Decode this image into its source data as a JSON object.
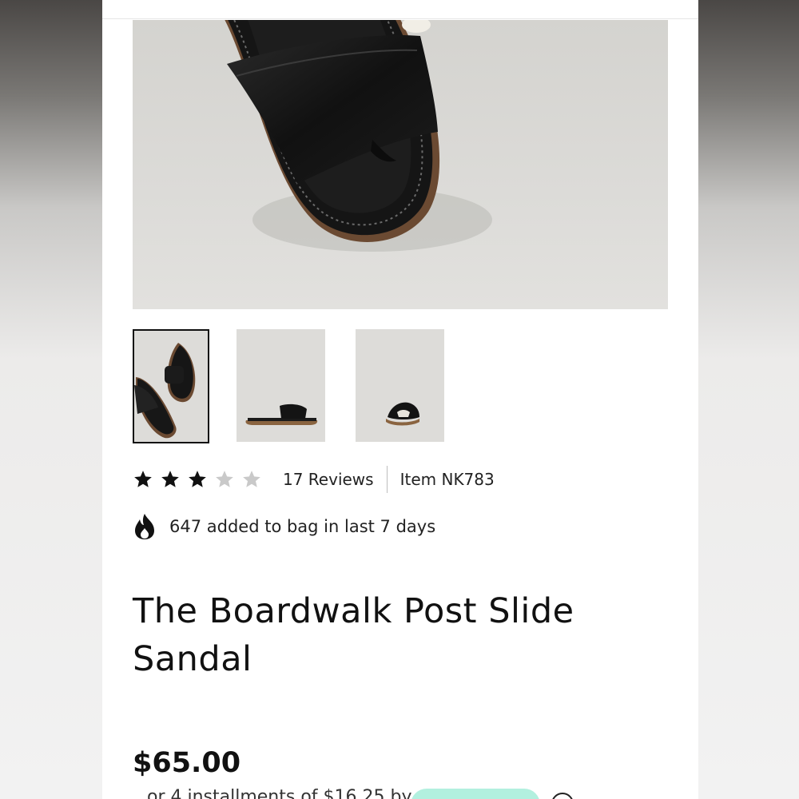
{
  "product": {
    "title": "The Boardwalk Post Slide Sandal",
    "price": "$65.00",
    "installments_text": "or 4 installments of $16.25 by"
  },
  "rating": {
    "value": 3,
    "max": 5,
    "reviews_label": "17 Reviews"
  },
  "item_number": "Item NK783",
  "social_proof": "647 added to bag in last 7 days",
  "gallery": {
    "selected_index": 0,
    "thumbnails": [
      "thumbnail-angled",
      "thumbnail-side",
      "thumbnail-front"
    ]
  },
  "icons": {
    "star": "star-icon",
    "flame": "flame-icon",
    "info": "info-icon"
  },
  "colors": {
    "star_filled": "#111111",
    "star_empty": "#c9c9c9",
    "pay_pill": "#b2f0df"
  }
}
